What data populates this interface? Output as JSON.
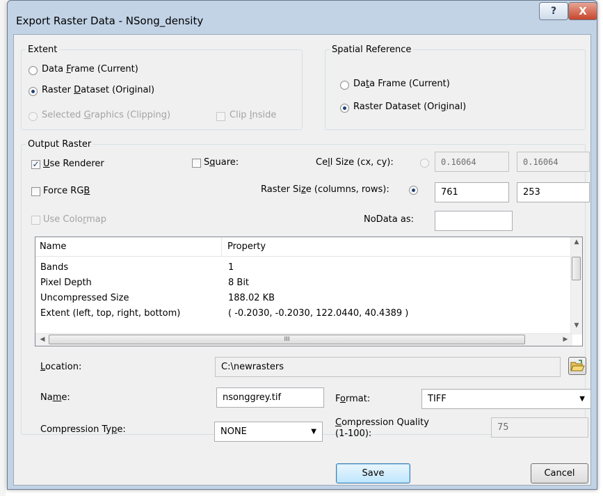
{
  "window": {
    "title": "Export Raster Data - NSong_density",
    "help_label": "?",
    "close_label": "X"
  },
  "extent": {
    "legend": "Extent",
    "data_frame": {
      "pre": "Data ",
      "key": "F",
      "post": "rame (Current)",
      "selected": false
    },
    "raster_dataset": {
      "pre": "Raster ",
      "key": "D",
      "post": "ataset (Original)",
      "selected": true
    },
    "selected_graphics": {
      "pre": "Selected ",
      "key": "G",
      "post": "raphics (Clipping)",
      "enabled": false
    },
    "clip_inside": {
      "pre": "Clip ",
      "key": "I",
      "post": "nside",
      "checked": false,
      "enabled": false
    }
  },
  "spatial_reference": {
    "legend": "Spatial Reference",
    "data_frame": {
      "pre": "Da",
      "key": "t",
      "post": "a Frame (Current)",
      "selected": false
    },
    "raster_dataset": {
      "pre": "Raster Dataset (Ori",
      "key": "g",
      "post": "inal)",
      "selected": true
    }
  },
  "output_raster": {
    "legend": "Output Raster",
    "use_renderer": {
      "pre": "",
      "key": "U",
      "post": "se Renderer",
      "checked": true
    },
    "square": {
      "pre": "S",
      "key": "q",
      "post": "uare:",
      "checked": false
    },
    "force_rgb": {
      "pre": "Force RG",
      "key": "B",
      "post": "",
      "checked": false
    },
    "use_colormap": {
      "pre": "Use Colo",
      "key": "r",
      "post": "map",
      "checked": false,
      "enabled": false
    },
    "cell_size": {
      "pre": "Ce",
      "key": "l",
      "post": "l Size (cx, cy):",
      "selected": false,
      "cx": "0.16064",
      "cy": "0.16064"
    },
    "raster_size": {
      "pre": "Raster Si",
      "key": "z",
      "post": "e (columns, rows):",
      "selected": true,
      "columns": "761",
      "rows": "253"
    },
    "nodata": {
      "label": "NoData as:",
      "value": ""
    }
  },
  "properties": {
    "columns": [
      "Name",
      "Property"
    ],
    "rows": [
      {
        "name": "Bands",
        "value": "1"
      },
      {
        "name": "Pixel Depth",
        "value": "8 Bit"
      },
      {
        "name": "Uncompressed Size",
        "value": "188.02 KB"
      },
      {
        "name": "Extent (left, top, right, bottom)",
        "value": "( -0.2030, -0.2030, 122.0440, 40.4389 )"
      }
    ],
    "thumb_grip": "III"
  },
  "location": {
    "pre": "",
    "key": "L",
    "post": "ocation:",
    "value": "C:\\newrasters"
  },
  "name": {
    "pre": "Na",
    "key": "m",
    "post": "e:",
    "value": "nsonggrey.tif"
  },
  "format": {
    "pre": "F",
    "key": "o",
    "post": "rmat:",
    "value": "TIFF"
  },
  "compression_type": {
    "pre": "Compression Ty",
    "key": "p",
    "post": "e:",
    "value": "NONE"
  },
  "compression_quality": {
    "pre": "",
    "key": "C",
    "post": "ompression Quality",
    "line2": "(1-100):",
    "value": "75"
  },
  "buttons": {
    "save": "Save",
    "cancel": "Cancel"
  },
  "colors": {
    "accent": "#1f3f76",
    "title_bar": "#c2d3e6",
    "close": "#c7452c"
  }
}
